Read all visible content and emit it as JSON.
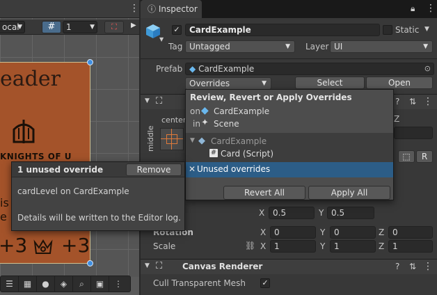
{
  "scene": {
    "dropdown_value": "ocal",
    "grid_value": "1",
    "card": {
      "title": "eader",
      "logo_text": "KNIGHTS OF U",
      "left_value": "+3",
      "right_value": "+3",
      "partial_text": "is",
      "partial_text2": "e"
    }
  },
  "inspector": {
    "tab_label": "Inspector",
    "object_name": "CardExample",
    "static_label": "Static",
    "tag_label": "Tag",
    "tag_value": "Untagged",
    "layer_label": "Layer",
    "layer_value": "UI",
    "prefab_label": "Prefab",
    "prefab_value": "CardExample",
    "overrides_label": "Overrides",
    "select_label": "Select",
    "open_label": "Open",
    "anchor_top_label": "center",
    "anchor_side_label": "middle",
    "z_label": "Z",
    "r_label": "R",
    "pivot": {
      "x_label": "X",
      "x_value": "0.5",
      "y_label": "Y",
      "y_value": "0.5"
    },
    "rotation": {
      "label": "Rotation",
      "x_label": "X",
      "x_value": "0",
      "y_label": "Y",
      "y_value": "0",
      "z_label": "Z",
      "z_value": "0"
    },
    "scale": {
      "label": "Scale",
      "x_label": "X",
      "x_value": "1",
      "y_label": "Y",
      "y_value": "1",
      "z_label": "Z",
      "z_value": "1"
    },
    "canvas_renderer": {
      "title": "Canvas Renderer",
      "cull_label": "Cull Transparent Mesh"
    }
  },
  "overrides_popup": {
    "title": "Review, Revert or Apply Overrides",
    "on_label": "on",
    "on_value": "CardExample",
    "in_label": "in",
    "in_value": "Scene",
    "tree_root": "CardExample",
    "tree_child": "Card (Script)",
    "unused_label": "Unused overrides",
    "revert_all": "Revert All",
    "apply_all": "Apply All"
  },
  "unused_popup": {
    "title": "1 unused override",
    "remove_label": "Remove",
    "entry": "cardLevel on CardExample",
    "note": "Details will be written to the Editor log."
  },
  "colors": {
    "accent_selection": "#2c5d87",
    "card_fill": "#a4532a",
    "handle_blue": "#3f8ee0"
  }
}
